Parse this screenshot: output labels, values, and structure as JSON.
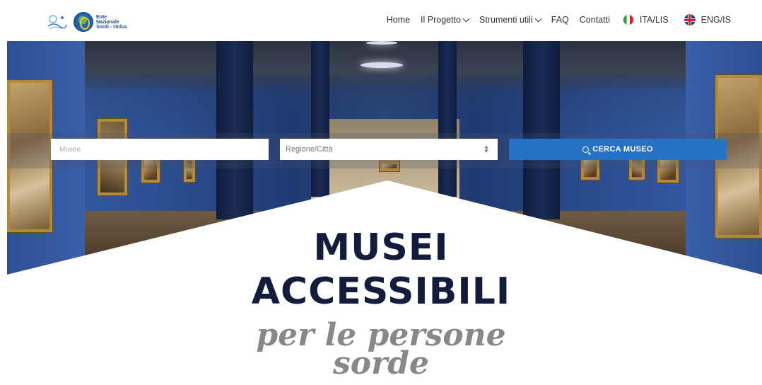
{
  "header": {
    "logo_text": [
      "Ente",
      "Nazionale",
      "Sordi - Onlus"
    ],
    "nav": [
      {
        "label": "Home",
        "dropdown": false
      },
      {
        "label": "Il Progetto",
        "dropdown": true
      },
      {
        "label": "Strumenti utili",
        "dropdown": true
      },
      {
        "label": "FAQ",
        "dropdown": false
      },
      {
        "label": "Contatti",
        "dropdown": false
      }
    ],
    "languages": [
      {
        "label": "ITA/LIS",
        "flag": "italy-flag"
      },
      {
        "label": "ENG/IS",
        "flag": "uk-flag"
      }
    ]
  },
  "search": {
    "museum_placeholder": "Museo",
    "region_label": "Regione/Città",
    "button_label": "CERCA MUSEO"
  },
  "hero": {
    "title_line1": "MUSEI",
    "title_line2": "ACCESSIBILI",
    "subtitle_line1": "per le persone",
    "subtitle_line2": "sorde"
  },
  "colors": {
    "accent": "#2872c6",
    "title": "#141c3c",
    "subtitle": "#888888"
  }
}
